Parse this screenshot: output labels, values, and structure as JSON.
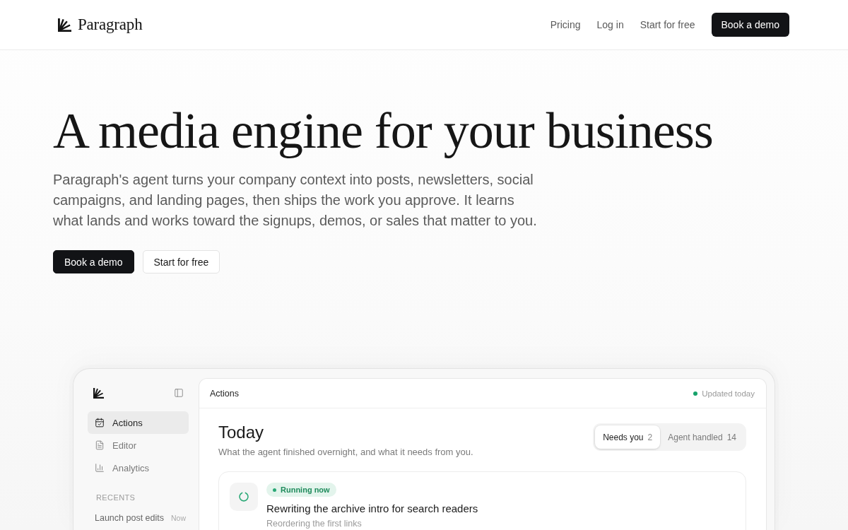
{
  "header": {
    "brand": "Paragraph",
    "nav": [
      "Pricing",
      "Log in",
      "Start for free"
    ],
    "cta": "Book a demo"
  },
  "hero": {
    "title": "A media engine for your business",
    "description": "Paragraph's agent turns your company context into posts, newsletters, social campaigns, and landing pages, then ships the work you approve. It learns what lands and works toward the signups, demos, or sales that matter to you.",
    "buttons": [
      {
        "label": "Book a demo",
        "kind": "primary"
      },
      {
        "label": "Start for free",
        "kind": "secondary"
      }
    ]
  },
  "app": {
    "sidebar": {
      "items": [
        {
          "label": "Actions",
          "selected": true
        },
        {
          "label": "Editor",
          "selected": false
        },
        {
          "label": "Analytics",
          "selected": false
        }
      ],
      "recents": {
        "heading": "RECENTS",
        "items": [
          {
            "title": "Launch post edits",
            "time": "Now"
          }
        ]
      }
    },
    "main": {
      "title": "Actions",
      "status": "Updated today",
      "heading": "Today",
      "subheading": "What the agent finished overnight, and what it needs from you.",
      "tabs": [
        {
          "label": "Needs you",
          "count": "2",
          "selected": true
        },
        {
          "label": "Agent handled",
          "count": "14",
          "selected": false
        }
      ],
      "tasks": [
        {
          "status": "Running now",
          "title": "Rewriting the archive intro for search readers",
          "detail": "Reordering the first links"
        }
      ]
    }
  }
}
